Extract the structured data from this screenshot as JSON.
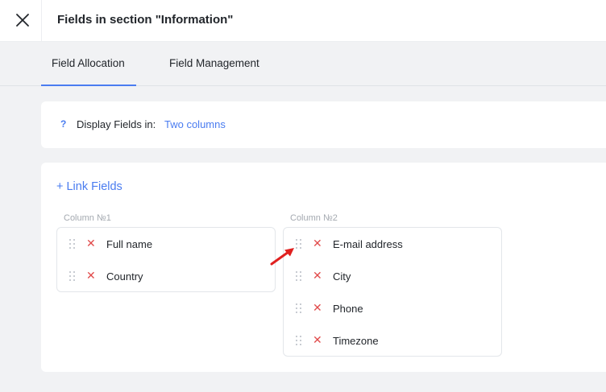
{
  "header": {
    "title": "Fields in section \"Information\"",
    "close_icon": "close-icon"
  },
  "tabs": [
    {
      "label": "Field Allocation",
      "active": true
    },
    {
      "label": "Field Management",
      "active": false
    }
  ],
  "display": {
    "help_glyph": "?",
    "label": "Display Fields in:",
    "value": "Two columns"
  },
  "fields": {
    "link_label": "+ Link Fields",
    "columns": [
      {
        "label": "Column №1",
        "items": [
          "Full name",
          "Country"
        ]
      },
      {
        "label": "Column №2",
        "items": [
          "E-mail address",
          "City",
          "Phone",
          "Timezone"
        ]
      }
    ]
  },
  "colors": {
    "accent": "#4a7cf0",
    "remove": "#e14b4b",
    "annotation_arrow": "#e0201f"
  }
}
